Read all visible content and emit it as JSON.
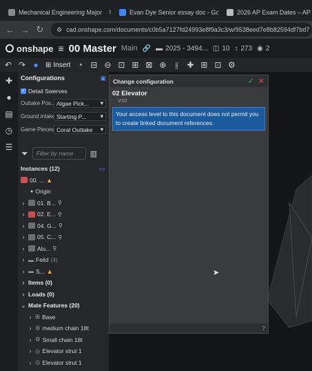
{
  "browser": {
    "tabs": [
      {
        "label": "Mechanical Engineering Major",
        "favicon_color": "#8a8a8a"
      },
      {
        "label": "Evan Dye Senior essay doc - Go",
        "favicon_color": "#4285f4"
      },
      {
        "label": "2026 AP Exam Dates – AP Cent",
        "favicon_color": "#bdbdbd"
      }
    ],
    "url": "cad.onshape.com/documents/c0b5a7127fd24993e8f9a3c3/w/9538eed7e8b82594df7bd7"
  },
  "onshape": {
    "logo_text": "onshape",
    "doc_title": "00 Master",
    "branch": "Main",
    "folder": "2025 - 3494...",
    "count1": "10",
    "count2": "273",
    "count3": "2"
  },
  "toolbar": {
    "insert_label": "Insert"
  },
  "config_panel": {
    "title": "Configurations",
    "detail_checkbox": "Detail Swerves",
    "rows": [
      {
        "label": "Outtake Pos...",
        "value": "Algae Pick..."
      },
      {
        "label": "Ground intake...",
        "value": "Starting P..."
      },
      {
        "label": "Game Pieces",
        "value": "Coral Outtake"
      }
    ]
  },
  "filter": {
    "placeholder": "Filter by name"
  },
  "tree": {
    "instances_label": "Instances (12)",
    "items": [
      {
        "label": "00. ...",
        "indent": 0,
        "expand": "",
        "warn": true
      },
      {
        "label": "Origin",
        "indent": 1,
        "expand": "",
        "warn": false
      },
      {
        "label": "01. B...",
        "indent": 0,
        "expand": "›",
        "warn": false
      },
      {
        "label": "02. E...",
        "indent": 0,
        "expand": "›",
        "warn": false
      },
      {
        "label": "04. G...",
        "indent": 0,
        "expand": "›",
        "warn": false
      },
      {
        "label": "05. C...",
        "indent": 0,
        "expand": "›",
        "warn": false
      },
      {
        "label": "Alu...",
        "indent": 0,
        "expand": "›",
        "warn": false
      },
      {
        "label": "Feild",
        "count": "(4)",
        "indent": 0,
        "expand": "›",
        "warn": false
      },
      {
        "label": "S...",
        "indent": 0,
        "expand": "›",
        "warn": true
      }
    ],
    "items_label": "Items (0)",
    "loads_label": "Loads (0)",
    "mate_label": "Mate Features (20)",
    "mates": [
      {
        "label": "Base"
      },
      {
        "label": "medium chain 18t"
      },
      {
        "label": "Small chain 18t"
      },
      {
        "label": "Elevator strut 1"
      },
      {
        "label": "Elevator strut 1"
      }
    ]
  },
  "dialog": {
    "title": "Change configuration",
    "part_name": "02 Elevator",
    "version": "V10",
    "message": "Your access level to this document does not permit you to create linked document references."
  }
}
